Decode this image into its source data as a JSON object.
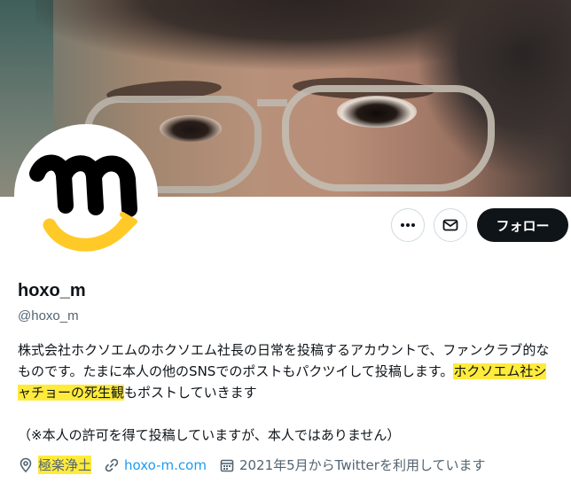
{
  "profile": {
    "display_name": "hoxo_m",
    "handle": "@hoxo_m",
    "bio_part1": "株式会社ホクソエムのホクソエム社長の日常を投稿するアカウントで、ファンクラブ的なものです。たまに本人の他のSNSでのポストもパクツイして投稿します。",
    "bio_highlight": "ホクソエム社シャチョーの死生観",
    "bio_part2": "もポストしていきます",
    "bio_note": "（※本人の許可を得て投稿していますが、本人ではありません）",
    "location": "極楽浄土",
    "website": "hoxo-m.com",
    "joined": "2021年5月からTwitterを利用しています"
  },
  "actions": {
    "more_icon": "more-horizontal-icon",
    "message_icon": "envelope-icon",
    "follow_label": "フォロー"
  },
  "icons": {
    "location": "location-pin-icon",
    "link": "link-icon",
    "calendar": "calendar-icon"
  },
  "colors": {
    "highlight": "#ffeb3b",
    "link": "#1d9bf0",
    "secondary_text": "#536471",
    "follow_button": "#0f1419",
    "avatar_glyph": "#000000",
    "avatar_smile": "#ffc928"
  }
}
